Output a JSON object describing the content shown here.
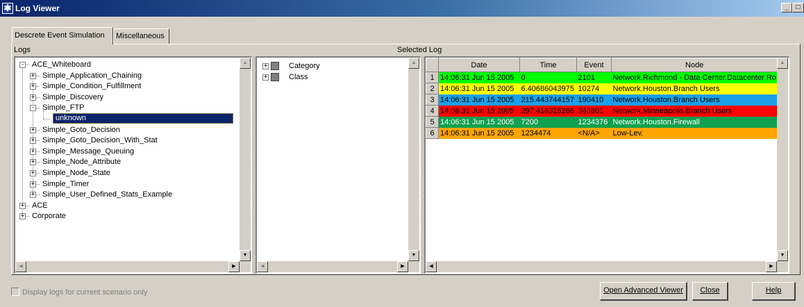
{
  "window": {
    "title": "Log Viewer",
    "icon": "asterisk-app-icon",
    "controls": [
      "_",
      "□",
      "x"
    ]
  },
  "tabs": [
    {
      "label": "Descrete Event Simulation",
      "active": true
    },
    {
      "label": "Miscellaneous",
      "active": false
    }
  ],
  "logs_panel": {
    "label": "Logs",
    "tree": [
      {
        "label": "ACE_Whiteboard",
        "level": 0,
        "expander": "-"
      },
      {
        "label": "Simple_Application_Chaining",
        "level": 1,
        "expander": "+"
      },
      {
        "label": "Simple_Condition_Fulfillment",
        "level": 1,
        "expander": "+"
      },
      {
        "label": "Simple_Discovery",
        "level": 1,
        "expander": "+"
      },
      {
        "label": "Simple_FTP",
        "level": 1,
        "expander": "-"
      },
      {
        "label": "unknown",
        "level": 2,
        "expander": "",
        "selected": true
      },
      {
        "label": "Simple_Goto_Decision",
        "level": 1,
        "expander": "+"
      },
      {
        "label": "Simple_Goto_Decision_With_Stat",
        "level": 1,
        "expander": "+"
      },
      {
        "label": "Simple_Message_Queuing",
        "level": 1,
        "expander": "+"
      },
      {
        "label": "Simple_Node_Attribute",
        "level": 1,
        "expander": "+"
      },
      {
        "label": "Simple_Node_State",
        "level": 1,
        "expander": "+"
      },
      {
        "label": "Simple_Timer",
        "level": 1,
        "expander": "+"
      },
      {
        "label": "Simple_User_Defined_Stats_Example",
        "level": 1,
        "expander": "+"
      },
      {
        "label": "ACE",
        "level": 0,
        "expander": "+"
      },
      {
        "label": "Corporate",
        "level": 0,
        "expander": "+"
      }
    ]
  },
  "filter_panel": {
    "items": [
      {
        "label": "Category",
        "expander": "+"
      },
      {
        "label": "Class",
        "expander": "+"
      }
    ]
  },
  "selected_log": {
    "label": "Selected Log",
    "columns": [
      "Date",
      "Time",
      "Event",
      "Node"
    ],
    "rows": [
      {
        "num": "1",
        "date": "14:06:31 Jun 15 2005",
        "time": "0",
        "event": "2101",
        "node": "Network.Richmond - Data Center.Datacenter Ro",
        "bg": "#00ff00",
        "fg": "#000000"
      },
      {
        "num": "2",
        "date": "14:06:31 Jun 15 2005",
        "time": "6.40686043975",
        "event": "10274",
        "node": "Network.Houston.Branch Users",
        "bg": "#ffff00",
        "fg": "#000000"
      },
      {
        "num": "3",
        "date": "14:06:31 Jun 15 2005",
        "time": "215.443744157",
        "event": "190410",
        "node": "Network.Houston.Branch Users",
        "bg": "#1aa0e8",
        "fg": "#000000"
      },
      {
        "num": "4",
        "date": "14:06:31 Jun 15 2005",
        "time": "297.418315266",
        "event": "343801",
        "node": "Network.Minneapolis.Branch Users",
        "bg": "#ff0000",
        "fg": "#000000"
      },
      {
        "num": "5",
        "date": "14:06:31 Jun 15 2005",
        "time": "7200",
        "event": "1234376",
        "node": "Network.Houston.Firewall",
        "bg": "#10a050",
        "fg": "#ffffff"
      },
      {
        "num": "6",
        "date": "14:06:31 Jun 15 2005",
        "time": "1234474",
        "event": "<N/A>",
        "node": "Low-Lev.",
        "bg": "#ffa500",
        "fg": "#000000"
      }
    ]
  },
  "footer": {
    "checkbox_label": "Display logs for current scenario only",
    "checkbox_checked": false,
    "buttons": {
      "open_advanced": "Open Advanced Viewer",
      "close": "Close",
      "help": "Help"
    }
  }
}
